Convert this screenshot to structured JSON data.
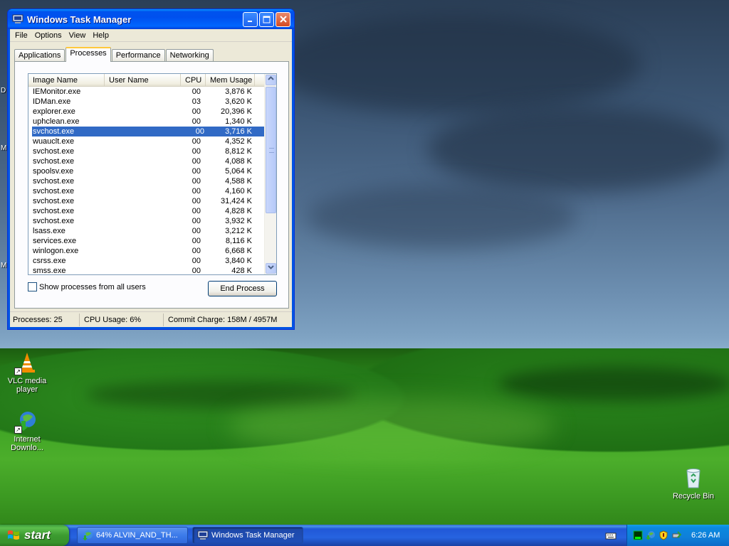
{
  "window": {
    "title": "Windows Task Manager",
    "menu": [
      "File",
      "Options",
      "View",
      "Help"
    ],
    "tabs": [
      "Applications",
      "Processes",
      "Performance",
      "Networking"
    ],
    "active_tab": "Processes",
    "columns": [
      "Image Name",
      "User Name",
      "CPU",
      "Mem Usage"
    ],
    "processes": [
      {
        "name": "IEMonitor.exe",
        "user": "",
        "cpu": "00",
        "mem": "3,876 K"
      },
      {
        "name": "IDMan.exe",
        "user": "",
        "cpu": "03",
        "mem": "3,620 K"
      },
      {
        "name": "explorer.exe",
        "user": "",
        "cpu": "00",
        "mem": "20,396 K"
      },
      {
        "name": "uphclean.exe",
        "user": "",
        "cpu": "00",
        "mem": "1,340 K"
      },
      {
        "name": "svchost.exe",
        "user": "",
        "cpu": "00",
        "mem": "3,716 K"
      },
      {
        "name": "wuauclt.exe",
        "user": "",
        "cpu": "00",
        "mem": "4,352 K"
      },
      {
        "name": "svchost.exe",
        "user": "",
        "cpu": "00",
        "mem": "8,812 K"
      },
      {
        "name": "svchost.exe",
        "user": "",
        "cpu": "00",
        "mem": "4,088 K"
      },
      {
        "name": "spoolsv.exe",
        "user": "",
        "cpu": "00",
        "mem": "5,064 K"
      },
      {
        "name": "svchost.exe",
        "user": "",
        "cpu": "00",
        "mem": "4,588 K"
      },
      {
        "name": "svchost.exe",
        "user": "",
        "cpu": "00",
        "mem": "4,160 K"
      },
      {
        "name": "svchost.exe",
        "user": "",
        "cpu": "00",
        "mem": "31,424 K"
      },
      {
        "name": "svchost.exe",
        "user": "",
        "cpu": "00",
        "mem": "4,828 K"
      },
      {
        "name": "svchost.exe",
        "user": "",
        "cpu": "00",
        "mem": "3,932 K"
      },
      {
        "name": "lsass.exe",
        "user": "",
        "cpu": "00",
        "mem": "3,212 K"
      },
      {
        "name": "services.exe",
        "user": "",
        "cpu": "00",
        "mem": "8,116 K"
      },
      {
        "name": "winlogon.exe",
        "user": "",
        "cpu": "00",
        "mem": "6,668 K"
      },
      {
        "name": "csrss.exe",
        "user": "",
        "cpu": "00",
        "mem": "3,840 K"
      },
      {
        "name": "smss.exe",
        "user": "",
        "cpu": "00",
        "mem": "428 K"
      }
    ],
    "selected_index": 4,
    "show_all_label": "Show processes from all users",
    "end_process_label": "End Process",
    "status": {
      "processes": "Processes: 25",
      "cpu": "CPU Usage: 6%",
      "commit": "Commit Charge: 158M / 4957M"
    }
  },
  "desktop_icons": [
    {
      "label_line1": "VLC media",
      "label_line2": "player",
      "icon": "vlc-cone-icon"
    },
    {
      "label_line1": "Internet",
      "label_line2": "Downlo...",
      "icon": "internet-download-manager-icon"
    },
    {
      "label_line1": "Recycle Bin",
      "label_line2": "",
      "icon": "recycle-bin-icon"
    }
  ],
  "edge_letters": [
    "D",
    "M",
    "M"
  ],
  "taskbar": {
    "start_label": "start",
    "buttons": [
      {
        "label": "64% ALVIN_AND_TH...",
        "icon": "download-globe-icon"
      },
      {
        "label": "Windows Task Manager",
        "icon": "task-manager-icon"
      }
    ],
    "clock": "6:26 AM"
  },
  "colors": {
    "selection": "#316ac5",
    "titlebar": "#0054e3",
    "start_green": "#3c9b30"
  }
}
